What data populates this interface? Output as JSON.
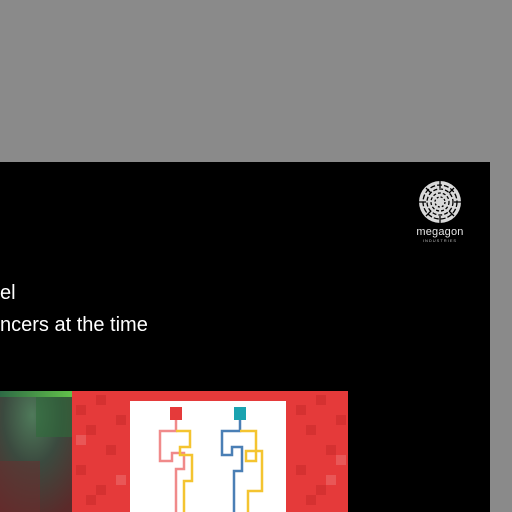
{
  "slide": {
    "logo": {
      "name": "megagon",
      "subtitle": "INDUSTRIES",
      "icon": "circular-maze-logo"
    },
    "lines": [
      "el",
      "ncers at the time"
    ],
    "images": [
      {
        "icon": "blurred-gradient-image"
      },
      {
        "icon": "red-grid-maze-image"
      }
    ]
  },
  "colors": {
    "desktop_background": "#8a8a8a",
    "slide_background": "#000000",
    "maze_red": "#e53a3a",
    "path_yellow": "#f4c430",
    "path_blue": "#4a7fb5",
    "path_pink": "#f08a8a",
    "marker_teal": "#1aa3b0"
  }
}
